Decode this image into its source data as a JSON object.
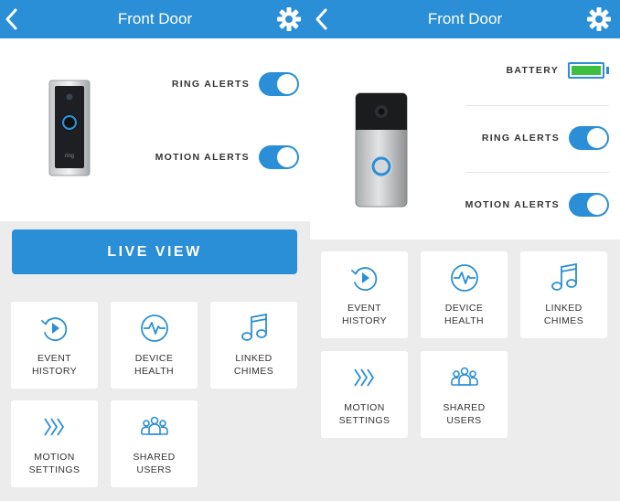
{
  "colors": {
    "accent": "#2a8fd6",
    "battery_fill": "#3fbf3f",
    "background": "#ececec"
  },
  "left_screen": {
    "header": {
      "title": "Front Door",
      "back_icon": "chevron-left-icon",
      "settings_icon": "gear-icon"
    },
    "settings": [
      {
        "label": "RING ALERTS",
        "enabled": true
      },
      {
        "label": "MOTION ALERTS",
        "enabled": true
      }
    ],
    "live_view_label": "LIVE VIEW",
    "tiles": [
      {
        "line1": "EVENT",
        "line2": "HISTORY",
        "icon": "event-history-icon"
      },
      {
        "line1": "DEVICE",
        "line2": "HEALTH",
        "icon": "device-health-icon"
      },
      {
        "line1": "LINKED",
        "line2": "CHIMES",
        "icon": "linked-chimes-icon"
      },
      {
        "line1": "MOTION",
        "line2": "SETTINGS",
        "icon": "motion-settings-icon"
      },
      {
        "line1": "SHARED",
        "line2": "USERS",
        "icon": "shared-users-icon"
      }
    ]
  },
  "right_screen": {
    "header": {
      "title": "Front Door",
      "back_icon": "chevron-left-icon",
      "settings_icon": "gear-icon"
    },
    "battery": {
      "label": "BATTERY",
      "level": 1.0
    },
    "settings": [
      {
        "label": "RING ALERTS",
        "enabled": true
      },
      {
        "label": "MOTION ALERTS",
        "enabled": true
      }
    ],
    "tiles": [
      {
        "line1": "EVENT",
        "line2": "HISTORY",
        "icon": "event-history-icon"
      },
      {
        "line1": "DEVICE",
        "line2": "HEALTH",
        "icon": "device-health-icon"
      },
      {
        "line1": "LINKED",
        "line2": "CHIMES",
        "icon": "linked-chimes-icon"
      },
      {
        "line1": "MOTION",
        "line2": "SETTINGS",
        "icon": "motion-settings-icon"
      },
      {
        "line1": "SHARED",
        "line2": "USERS",
        "icon": "shared-users-icon"
      }
    ]
  }
}
